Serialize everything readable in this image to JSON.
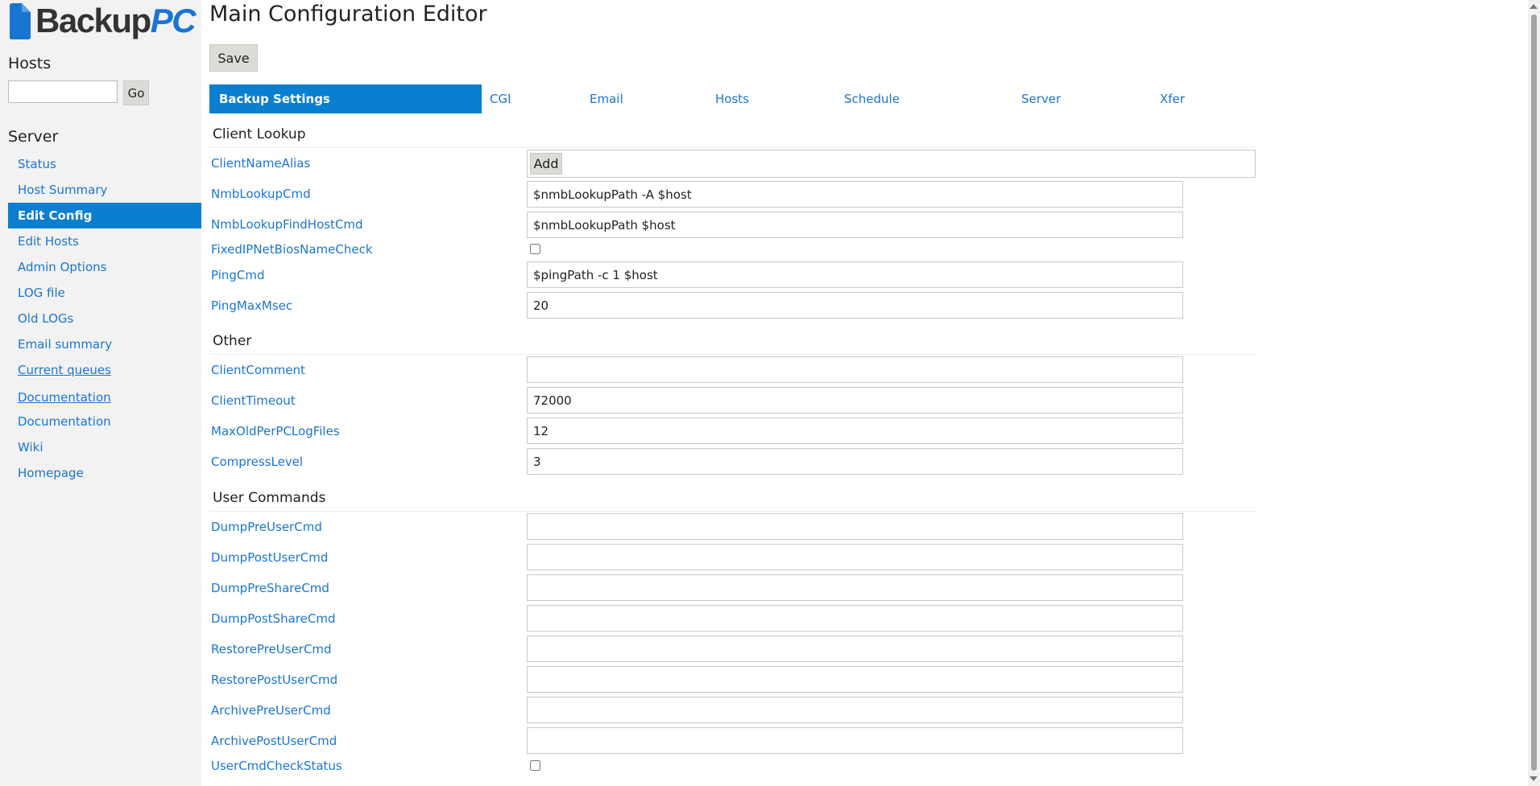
{
  "brand": {
    "text": "Backup",
    "accent": "PC"
  },
  "sidebar": {
    "hosts_heading": "Hosts",
    "go_label": "Go",
    "server_heading": "Server",
    "items": [
      {
        "label": "Status"
      },
      {
        "label": "Host Summary"
      },
      {
        "label": "Edit Config",
        "active": true
      },
      {
        "label": "Edit Hosts"
      },
      {
        "label": "Admin Options"
      },
      {
        "label": "LOG file"
      },
      {
        "label": "Old LOGs"
      },
      {
        "label": "Email summary"
      },
      {
        "label": "Current queues"
      },
      {
        "label": "Documentation"
      },
      {
        "label": "Documentation"
      },
      {
        "label": "Wiki"
      },
      {
        "label": "Homepage"
      }
    ]
  },
  "main": {
    "title": "Main Configuration Editor",
    "save_label": "Save",
    "tabs": [
      {
        "label": "Backup Settings",
        "active": true
      },
      {
        "label": "CGI"
      },
      {
        "label": "Email"
      },
      {
        "label": "Hosts"
      },
      {
        "label": "Schedule"
      },
      {
        "label": "Server"
      },
      {
        "label": "Xfer"
      }
    ],
    "sections": {
      "client_lookup": "Client Lookup",
      "other": "Other",
      "user_commands": "User Commands"
    },
    "add_label": "Add",
    "fields": {
      "ClientNameAlias": {
        "label": "ClientNameAlias"
      },
      "NmbLookupCmd": {
        "label": "NmbLookupCmd",
        "value": "$nmbLookupPath -A $host"
      },
      "NmbLookupFindHostCmd": {
        "label": "NmbLookupFindHostCmd",
        "value": "$nmbLookupPath $host"
      },
      "FixedIPNetBiosNameCheck": {
        "label": "FixedIPNetBiosNameCheck",
        "checked": false
      },
      "PingCmd": {
        "label": "PingCmd",
        "value": "$pingPath -c 1 $host"
      },
      "PingMaxMsec": {
        "label": "PingMaxMsec",
        "value": "20"
      },
      "ClientComment": {
        "label": "ClientComment",
        "value": ""
      },
      "ClientTimeout": {
        "label": "ClientTimeout",
        "value": "72000"
      },
      "MaxOldPerPCLogFiles": {
        "label": "MaxOldPerPCLogFiles",
        "value": "12"
      },
      "CompressLevel": {
        "label": "CompressLevel",
        "value": "3"
      },
      "DumpPreUserCmd": {
        "label": "DumpPreUserCmd",
        "value": ""
      },
      "DumpPostUserCmd": {
        "label": "DumpPostUserCmd",
        "value": ""
      },
      "DumpPreShareCmd": {
        "label": "DumpPreShareCmd",
        "value": ""
      },
      "DumpPostShareCmd": {
        "label": "DumpPostShareCmd",
        "value": ""
      },
      "RestorePreUserCmd": {
        "label": "RestorePreUserCmd",
        "value": ""
      },
      "RestorePostUserCmd": {
        "label": "RestorePostUserCmd",
        "value": ""
      },
      "ArchivePreUserCmd": {
        "label": "ArchivePreUserCmd",
        "value": ""
      },
      "ArchivePostUserCmd": {
        "label": "ArchivePostUserCmd",
        "value": ""
      },
      "UserCmdCheckStatus": {
        "label": "UserCmdCheckStatus",
        "checked": false
      }
    }
  },
  "colors": {
    "accent": "#0a7ecf",
    "link": "#1a75d2",
    "sidebar_bg": "#f2f2f2"
  }
}
